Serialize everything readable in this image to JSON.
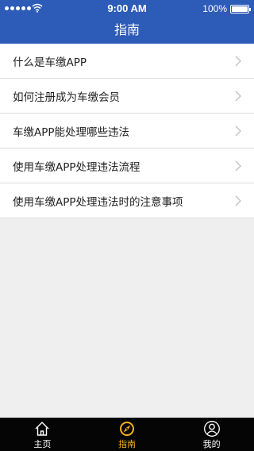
{
  "status_bar": {
    "time": "9:00 AM",
    "battery": "100%",
    "battery_level": 1.0,
    "signal_icon": "signal-dots-icon",
    "wifi_icon": "wifi-icon",
    "battery_icon": "battery-icon"
  },
  "header": {
    "title": "指南"
  },
  "guide_list": {
    "items": [
      {
        "label": "什么是车缴APP",
        "icon": "chevron-right-icon"
      },
      {
        "label": "如何注册成为车缴会员",
        "icon": "chevron-right-icon"
      },
      {
        "label": "车缴APP能处理哪些违法",
        "icon": "chevron-right-icon"
      },
      {
        "label": "使用车缴APP处理违法流程",
        "icon": "chevron-right-icon"
      },
      {
        "label": "使用车缴APP处理违法时的注意事项",
        "icon": "chevron-right-icon"
      }
    ]
  },
  "tab_bar": {
    "tabs": [
      {
        "label": "主页",
        "icon": "home-icon",
        "active": false
      },
      {
        "label": "指南",
        "icon": "compass-icon",
        "active": true
      },
      {
        "label": "我的",
        "icon": "user-icon",
        "active": false
      }
    ]
  },
  "colors": {
    "header_bg": "#2d5bb8",
    "tab_bar_bg": "#050505",
    "active_tab": "#f3b31c",
    "page_bg": "#efefef"
  }
}
